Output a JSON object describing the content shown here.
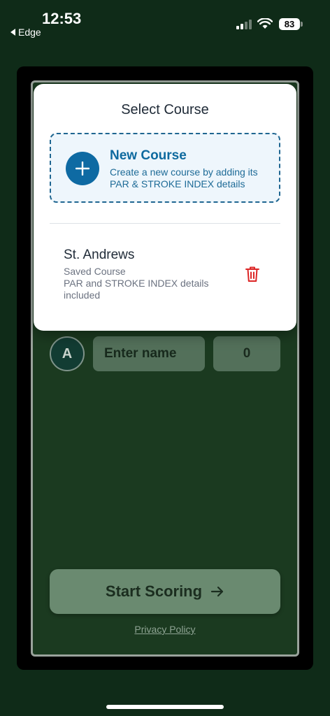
{
  "status_bar": {
    "time": "12:53",
    "back_app": "Edge",
    "battery": "83"
  },
  "modal": {
    "title": "Select Course",
    "new_course": {
      "title": "New Course",
      "description": "Create a new course by adding its PAR & STROKE INDEX details",
      "icon": "plus-icon"
    },
    "saved_courses": [
      {
        "name": "St. Andrews",
        "subtitle": "Saved Course",
        "details": "PAR and STROKE INDEX details included"
      }
    ]
  },
  "player_row": {
    "avatar_letter": "A",
    "name_placeholder": "Enter name",
    "score": "0"
  },
  "start_button": {
    "label": "Start Scoring",
    "icon": "arrow-right-icon"
  },
  "privacy_link": "Privacy Policy",
  "colors": {
    "background": "#0f2b18",
    "app_bg": "#1b3a20",
    "accent_blue": "#0e6aa3",
    "delete_red": "#dc2626"
  }
}
